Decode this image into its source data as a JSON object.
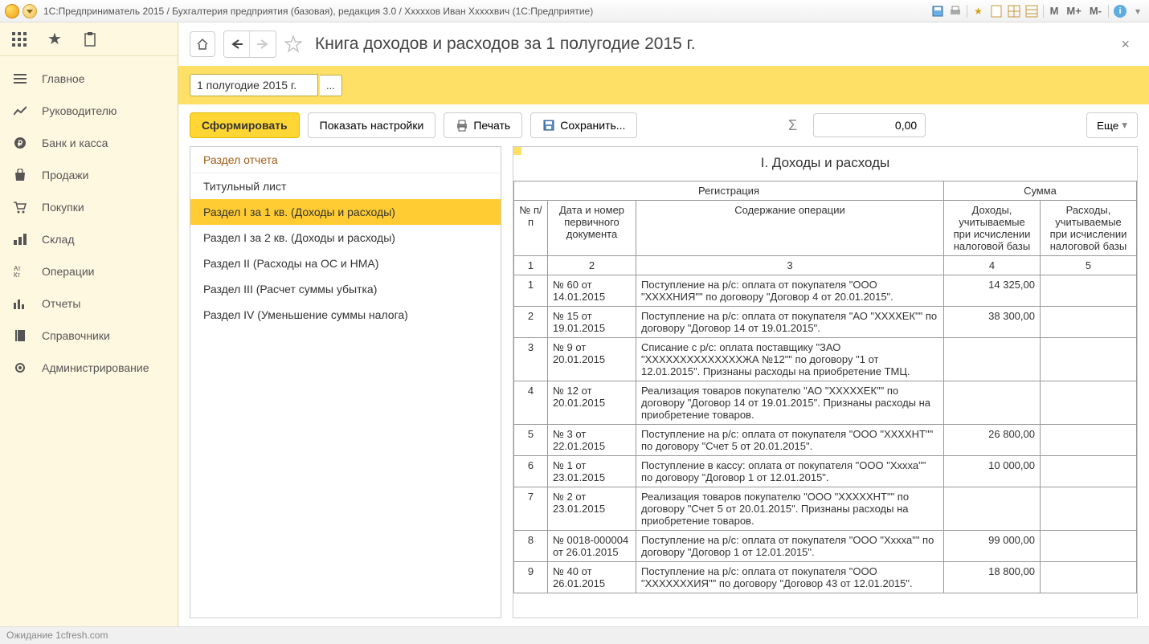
{
  "titlebar": {
    "text": "1С:Предприниматель 2015 / Бухгалтерия предприятия (базовая), редакция 3.0 / Хххххов Иван Хххххвич  (1С:Предприятие)",
    "m_buttons": [
      "M",
      "M+",
      "M-"
    ]
  },
  "sidebar": {
    "items": [
      {
        "icon": "menu",
        "label": "Главное"
      },
      {
        "icon": "chart",
        "label": "Руководителю"
      },
      {
        "icon": "ruble",
        "label": "Банк и касса"
      },
      {
        "icon": "bag",
        "label": "Продажи"
      },
      {
        "icon": "cart",
        "label": "Покупки"
      },
      {
        "icon": "stock",
        "label": "Склад"
      },
      {
        "icon": "ops",
        "label": "Операции"
      },
      {
        "icon": "reports",
        "label": "Отчеты"
      },
      {
        "icon": "book",
        "label": "Справочники"
      },
      {
        "icon": "gear",
        "label": "Администрирование"
      }
    ]
  },
  "header": {
    "title": "Книга доходов и расходов за 1 полугодие 2015 г."
  },
  "period": {
    "value": "1 полугодие 2015 г.",
    "picker": "..."
  },
  "toolbar": {
    "form": "Сформировать",
    "settings": "Показать настройки",
    "print": "Печать",
    "save": "Сохранить...",
    "num_value": "0,00",
    "more": "Еще"
  },
  "sections": {
    "header": "Раздел отчета",
    "items": [
      {
        "label": "Титульный лист",
        "active": false
      },
      {
        "label": "Раздел I за 1 кв. (Доходы и расходы)",
        "active": true
      },
      {
        "label": "Раздел I за 2 кв. (Доходы и расходы)",
        "active": false
      },
      {
        "label": "Раздел II (Расходы на ОС и НМА)",
        "active": false
      },
      {
        "label": "Раздел III (Расчет суммы убытка)",
        "active": false
      },
      {
        "label": "Раздел IV (Уменьшение суммы налога)",
        "active": false
      }
    ]
  },
  "report": {
    "title": "I. Доходы и расходы",
    "head": {
      "reg": "Регистрация",
      "sum": "Сумма",
      "npp": "№ п/п",
      "datedoc": "Дата и номер первичного документа",
      "operation": "Содержание операции",
      "income": "Доходы, учитываемые при исчислении налоговой базы",
      "expense": "Расходы, учитываемые при исчислении налоговой базы"
    },
    "idx": [
      "1",
      "2",
      "3",
      "4",
      "5"
    ],
    "rows": [
      {
        "n": "1",
        "doc": "№ 60 от 14.01.2015",
        "op": "Поступление на р/с: оплата от покупателя \"ООО \"ХХХХНИЯ\"\" по договору \"Договор 4 от 20.01.2015\".",
        "inc": "14 325,00",
        "exp": ""
      },
      {
        "n": "2",
        "doc": "№ 15 от 19.01.2015",
        "op": "Поступление на р/с: оплата от покупателя \"АО \"ХХХХЕК\"\" по договору \"Договор 14 от 19.01.2015\".",
        "inc": "38 300,00",
        "exp": ""
      },
      {
        "n": "3",
        "doc": "№ 9 от 20.01.2015",
        "op": "Списание с р/с: оплата поставщику \"ЗАО \"ХХХХХХХХХХХХХХЖА №12\"\" по договору \"1 от 12.01.2015\". Признаны расходы на приобретение ТМЦ.",
        "inc": "",
        "exp": ""
      },
      {
        "n": "4",
        "doc": "№ 12 от 20.01.2015",
        "op": "Реализация товаров покупателю \"АО \"ХХХХХЕК\"\" по договору \"Договор 14 от 19.01.2015\". Признаны расходы на приобретение товаров.",
        "inc": "",
        "exp": ""
      },
      {
        "n": "5",
        "doc": "№ 3 от 22.01.2015",
        "op": "Поступление на р/с: оплата от покупателя \"ООО \"ХХХХНТ\"\" по договору \"Счет 5 от 20.01.2015\".",
        "inc": "26 800,00",
        "exp": ""
      },
      {
        "n": "6",
        "doc": "№ 1 от 23.01.2015",
        "op": "Поступление в кассу: оплата от покупателя \"ООО \"Хххха\"\" по договору \"Договор 1 от 12.01.2015\".",
        "inc": "10 000,00",
        "exp": ""
      },
      {
        "n": "7",
        "doc": "№ 2 от 23.01.2015",
        "op": "Реализация товаров покупателю \"ООО \"ХХХХХНТ\"\" по договору \"Счет 5 от 20.01.2015\". Признаны расходы на приобретение товаров.",
        "inc": "",
        "exp": ""
      },
      {
        "n": "8",
        "doc": "№ 0018-000004 от 26.01.2015",
        "op": "Поступление на р/с: оплата от покупателя \"ООО \"Хххха\"\" по договору \"Договор 1 от 12.01.2015\".",
        "inc": "99 000,00",
        "exp": ""
      },
      {
        "n": "9",
        "doc": "№ 40 от 26.01.2015",
        "op": "Поступление на р/с: оплата от покупателя \"ООО \"ХХХХХХХИЯ\"\" по договору \"Договор 43 от 12.01.2015\".",
        "inc": "18 800,00",
        "exp": ""
      }
    ]
  },
  "statusbar": {
    "text": "Ожидание 1cfresh.com"
  }
}
